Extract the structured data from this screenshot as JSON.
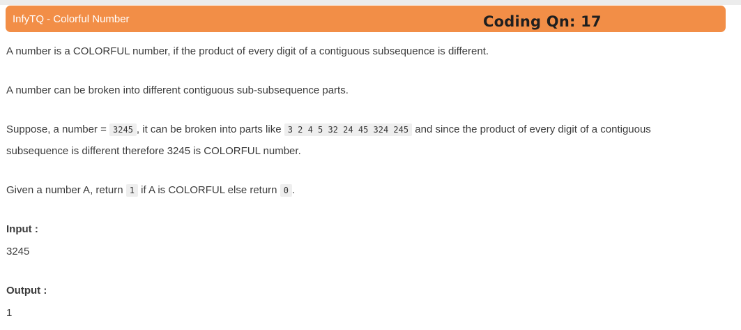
{
  "header": {
    "title": "InfyTQ - Colorful Number",
    "question": "Coding Qn: 17"
  },
  "problem": {
    "p1": "A number is a COLORFUL number, if the product of every digit of a contiguous subsequence is different.",
    "p2": "A number can be broken into different contiguous sub-subsequence parts.",
    "p3_before": "Suppose, a number = ",
    "p3_code1": "3245",
    "p3_middle": ", it can be broken into parts like ",
    "p3_code2": "3 2 4 5 32 24 45 324 245",
    "p3_after": " and since the product of every digit of a contiguous",
    "p3_line2": "subsequence is different therefore 3245 is COLORFUL number.",
    "p4_before": "Given a number A, return ",
    "p4_code1": "1",
    "p4_middle": " if A is COLORFUL else return ",
    "p4_code2": "0",
    "p4_after": "."
  },
  "example": {
    "input_label": "Input :",
    "input_value": "3245",
    "output_label": "Output :",
    "output_value": "1"
  },
  "colors": {
    "header_bg": "#f28e47",
    "header_text": "#ffffff",
    "code_bg": "#eeeeee"
  }
}
